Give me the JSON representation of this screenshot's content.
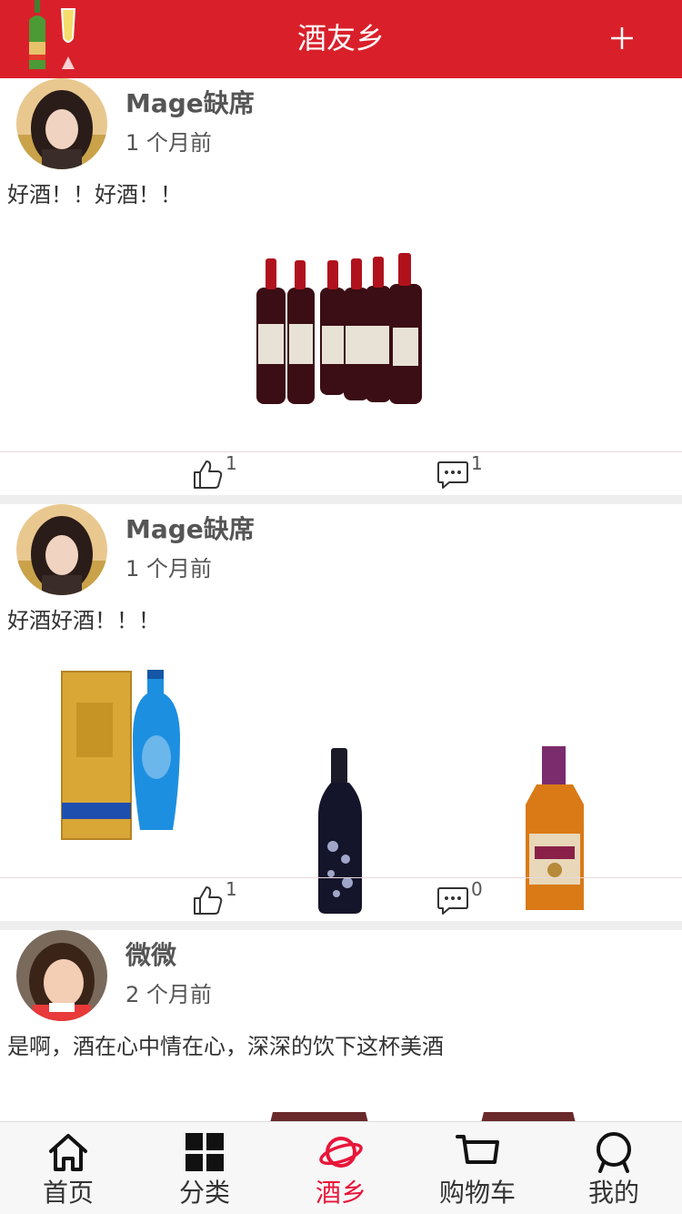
{
  "header": {
    "title": "酒友乡"
  },
  "posts": [
    {
      "username": "Mage缺席",
      "time": "1 个月前",
      "content": "好酒！！好酒！！",
      "likes": "1",
      "comments": "1"
    },
    {
      "username": "Mage缺席",
      "time": "1 个月前",
      "content": "好酒好酒！！！",
      "likes": "1",
      "comments": "0"
    },
    {
      "username": "微微",
      "time": "2 个月前",
      "content": "是啊，酒在心中情在心，深深的饮下这杯美酒"
    }
  ],
  "tabs": [
    {
      "label": "首页",
      "icon": "home-icon"
    },
    {
      "label": "分类",
      "icon": "category-grid-icon"
    },
    {
      "label": "酒乡",
      "icon": "planet-icon",
      "active": true
    },
    {
      "label": "购物车",
      "icon": "cart-icon"
    },
    {
      "label": "我的",
      "icon": "user-icon"
    }
  ],
  "colors": {
    "brand": "#d9202a",
    "active_tab": "#e8163a"
  }
}
